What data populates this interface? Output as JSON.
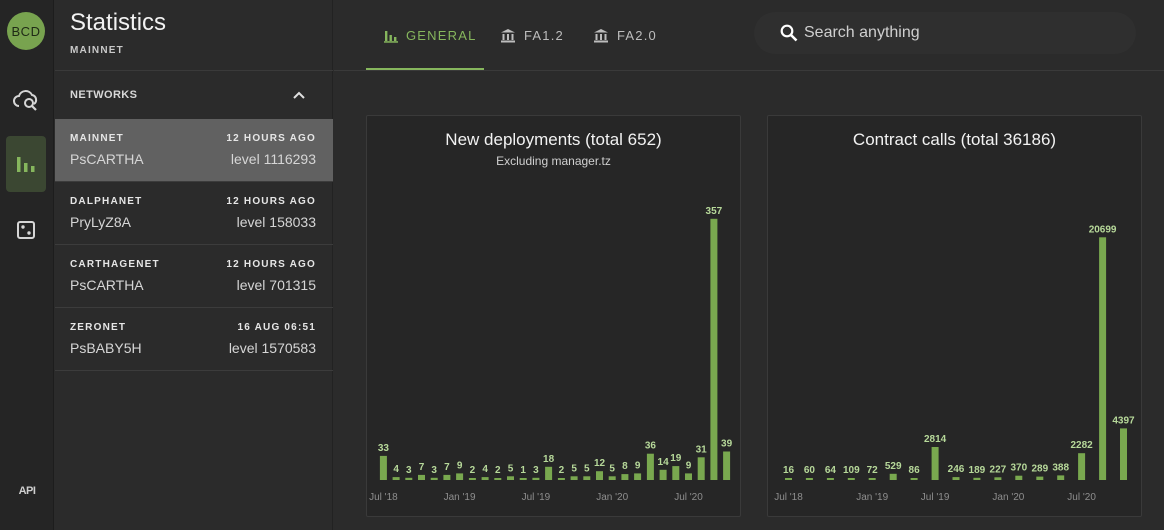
{
  "app": {
    "logo_text": "BCD",
    "api_label": "API"
  },
  "sidebar": {
    "title": "Statistics",
    "subtitle": "MAINNET",
    "section_label": "NETWORKS",
    "networks": [
      {
        "name": "MAINNET",
        "time": "12 HOURS AGO",
        "protocol": "PsCARTHA",
        "level": "level 1116293"
      },
      {
        "name": "DALPHANET",
        "time": "12 HOURS AGO",
        "protocol": "PryLyZ8A",
        "level": "level 158033"
      },
      {
        "name": "CARTHAGENET",
        "time": "12 HOURS AGO",
        "protocol": "PsCARTHA",
        "level": "level 701315"
      },
      {
        "name": "ZERONET",
        "time": "16 AUG 06:51",
        "protocol": "PsBABY5H",
        "level": "level 1570583"
      }
    ]
  },
  "tabs": [
    {
      "label": "GENERAL",
      "icon": "bar-chart-icon",
      "active": true
    },
    {
      "label": "FA1.2",
      "icon": "bank-icon",
      "active": false
    },
    {
      "label": "FA2.0",
      "icon": "bank-icon",
      "active": false
    }
  ],
  "search": {
    "placeholder": "Search anything",
    "value": ""
  },
  "colors": {
    "accent": "#86b65d",
    "bar": "#79a84f",
    "selected_row": "#616161"
  },
  "chart_data": [
    {
      "type": "bar",
      "title": "New deployments (total 652)",
      "subtitle": "Excluding manager.tz",
      "values": [
        33,
        4,
        3,
        7,
        3,
        7,
        9,
        2,
        4,
        2,
        5,
        1,
        3,
        18,
        2,
        5,
        5,
        12,
        5,
        8,
        9,
        36,
        14,
        19,
        9,
        31,
        357,
        39
      ],
      "xticks": [
        {
          "label": "Jul '18",
          "index": 0.5
        },
        {
          "label": "Jan '19",
          "index": 6.5
        },
        {
          "label": "Jul '19",
          "index": 12.5
        },
        {
          "label": "Jan '20",
          "index": 18.5
        },
        {
          "label": "Jul '20",
          "index": 24.5
        }
      ],
      "ylim": [
        0,
        380
      ],
      "grid": false,
      "legend": "none"
    },
    {
      "type": "bar",
      "title": "Contract calls (total 36186)",
      "subtitle": "",
      "values": [
        16,
        60,
        64,
        109,
        72,
        529,
        86,
        2814,
        246,
        189,
        227,
        370,
        289,
        388,
        2282,
        20699,
        4397
      ],
      "value_labels": [
        "16",
        "60",
        "64",
        "109",
        "72",
        "529",
        "86",
        "2814",
        "246",
        "189",
        "227",
        "370",
        "289",
        "388",
        "2282",
        "20699",
        "4397"
      ],
      "xticks": [
        {
          "label": "Jul '18",
          "index": 0.5
        },
        {
          "label": "Jan '19",
          "index": 4.5
        },
        {
          "label": "Jul '19",
          "index": 7.5
        },
        {
          "label": "Jan '20",
          "index": 11.0
        },
        {
          "label": "Jul '20",
          "index": 14.5
        }
      ],
      "ylim": [
        0,
        22000
      ],
      "grid": false,
      "legend": "none"
    }
  ]
}
